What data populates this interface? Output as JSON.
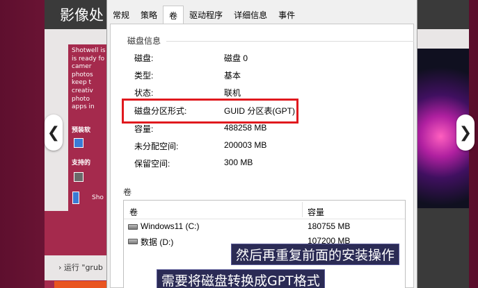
{
  "background_app": {
    "title": "影像处",
    "description": "Shotwell is\nis ready fo\ncamer\nphotos\nkeep t\ncreativ\nphoto\napps in",
    "preinstalled_label": "预装软",
    "supports_label": "支持的",
    "screenshot_label": "Sho",
    "command_text": "› 运行 \"grub",
    "nav_left": "❮",
    "nav_right": "❯"
  },
  "dialog": {
    "tabs": [
      {
        "label": "常规"
      },
      {
        "label": "策略"
      },
      {
        "label": "卷"
      },
      {
        "label": "驱动程序"
      },
      {
        "label": "详细信息"
      },
      {
        "label": "事件"
      }
    ],
    "active_tab": "卷",
    "disk_info": {
      "group_title": "磁盘信息",
      "rows": [
        {
          "label": "磁盘:",
          "value": "磁盘 0"
        },
        {
          "label": "类型:",
          "value": "基本"
        },
        {
          "label": "状态:",
          "value": "联机"
        },
        {
          "label": "磁盘分区形式:",
          "value": "GUID 分区表(GPT)"
        },
        {
          "label": "容量:",
          "value": "488258 MB"
        },
        {
          "label": "未分配空间:",
          "value": "200003 MB"
        },
        {
          "label": "保留空间:",
          "value": "300 MB"
        }
      ]
    },
    "volumes": {
      "group_title": "卷",
      "columns": [
        "卷",
        "容量"
      ],
      "rows": [
        {
          "name": "Windows11 (C:)",
          "size": "180755 MB"
        },
        {
          "name": "数据 (D:)",
          "size": "107200 MB"
        }
      ]
    }
  },
  "subtitles": {
    "line1": "然后再重复前面的安装操作",
    "line2": "需要将磁盘转换成GPT格式"
  },
  "colors": {
    "highlight": "#e0191e",
    "accent_orange": "#e95420",
    "subtitle_bg": "#2b2b55"
  }
}
